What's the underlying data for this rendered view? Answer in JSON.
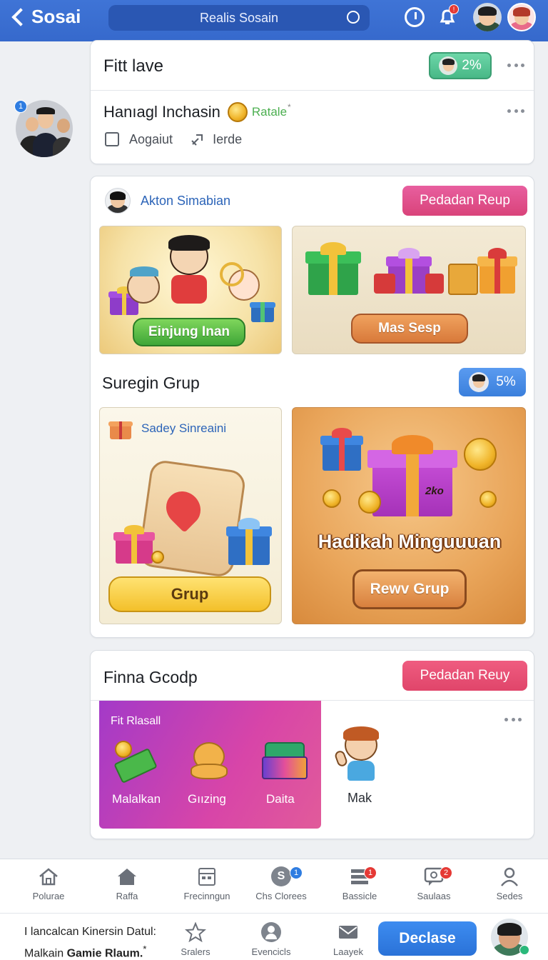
{
  "header": {
    "back_label": "Sosai",
    "search_placeholder": "Realis Sosain",
    "notification_badge": "!"
  },
  "card1": {
    "title": "Fitt lave",
    "percent_badge": "2%",
    "row_title": "Hanıagl Inchasin",
    "row_tag": "Ratale",
    "row_tag_mark": "*",
    "checkbox_label": "Aogaiut",
    "link_label": "Ierde",
    "side_avatar_badge": "1"
  },
  "card2": {
    "author": "Akton Simabian",
    "action_button": "Pedadan Reup",
    "tile1_button": "Einjung Inan",
    "tile2_button": "Mas Sesp",
    "section_title": "Suregin Grup",
    "section_badge": "5%",
    "tile3_title": "Sadey Sinreaini",
    "tile3_button": "Grup",
    "tile4_title": "Hadikah Minguuuan",
    "tile4_button": "Rewv Grup",
    "tile4_coin_text": "2ko"
  },
  "card3": {
    "title": "Finna Gcodp",
    "action_button": "Pedadan Reuy",
    "panel_title": "Fit Rlasall",
    "items": [
      "Malalkan",
      "Gıızing",
      "Daita"
    ],
    "side_item": "Mak"
  },
  "nav": {
    "items": [
      {
        "label": "Polurae",
        "icon": "home-icon"
      },
      {
        "label": "Raffa",
        "icon": "house-icon"
      },
      {
        "label": "Frecinngun",
        "icon": "calendar-icon"
      },
      {
        "label": "Chs Clorees",
        "icon": "coin-icon",
        "badge": "1"
      },
      {
        "label": "Bassicle",
        "icon": "list-icon",
        "badge": "1"
      },
      {
        "label": "Saulaas",
        "icon": "chat-icon",
        "badge": "2"
      },
      {
        "label": "Sedes",
        "icon": "profile-icon"
      }
    ]
  },
  "footer": {
    "text_line1": "I lancalcan Kinersin Datul:",
    "text_line2_prefix": "Malkain ",
    "text_line2_bold": "Gamie Rlaum.",
    "text_line2_suffix": "*",
    "items": [
      {
        "label": "Sralers",
        "icon": "star-icon"
      },
      {
        "label": "Evencicls",
        "icon": "person-icon"
      },
      {
        "label": "Laayek",
        "icon": "mail-icon"
      }
    ],
    "cta_button": "Declase"
  },
  "colors": {
    "header_blue": "#3669cc",
    "pink_button": "#e0487f",
    "teal_badge": "#5cc99a",
    "blue_badge": "#3f86e0",
    "cta_blue": "#2f7de1"
  }
}
